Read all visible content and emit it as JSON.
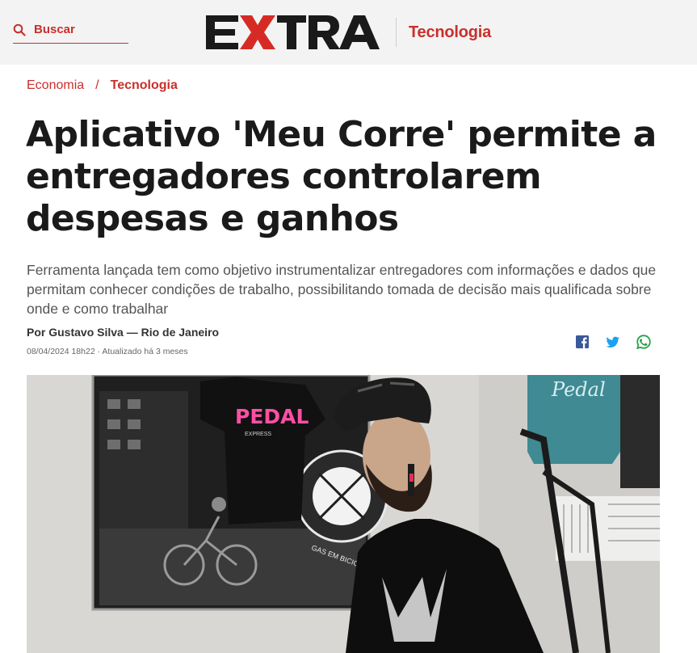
{
  "header": {
    "search_label": "Buscar",
    "logo_text": "EXTRA",
    "section": "Tecnologia",
    "accent_color": "#c9302c"
  },
  "breadcrumb": {
    "items": [
      "Economia",
      "Tecnologia"
    ],
    "separator": "/"
  },
  "article": {
    "headline": "Aplicativo 'Meu Corre' permite a entregadores controlarem despesas e ganhos",
    "subtitle": "Ferramenta lançada tem como objetivo instrumentalizar entregadores com informações e dados que permitam conhecer condições de trabalho, possibilitando tomada de decisão mais qualificada sobre onde e como trabalhar",
    "byline": "Por Gustavo Silva — Rio de Janeiro",
    "dateline": "08/04/2024 18h22 · Atualizado há 3 meses"
  },
  "share": {
    "icons": [
      "facebook-icon",
      "twitter-icon",
      "whatsapp-icon"
    ],
    "colors": {
      "facebook": "#3b5998",
      "twitter": "#1da1f2",
      "whatsapp": "#25a244"
    }
  },
  "photo": {
    "shirt_text_1": "PEDAL",
    "shirt_text_2": "EXPRESS",
    "shirt_text_3": "Pedal",
    "poster_text": "GAS EM BICICLETA"
  }
}
